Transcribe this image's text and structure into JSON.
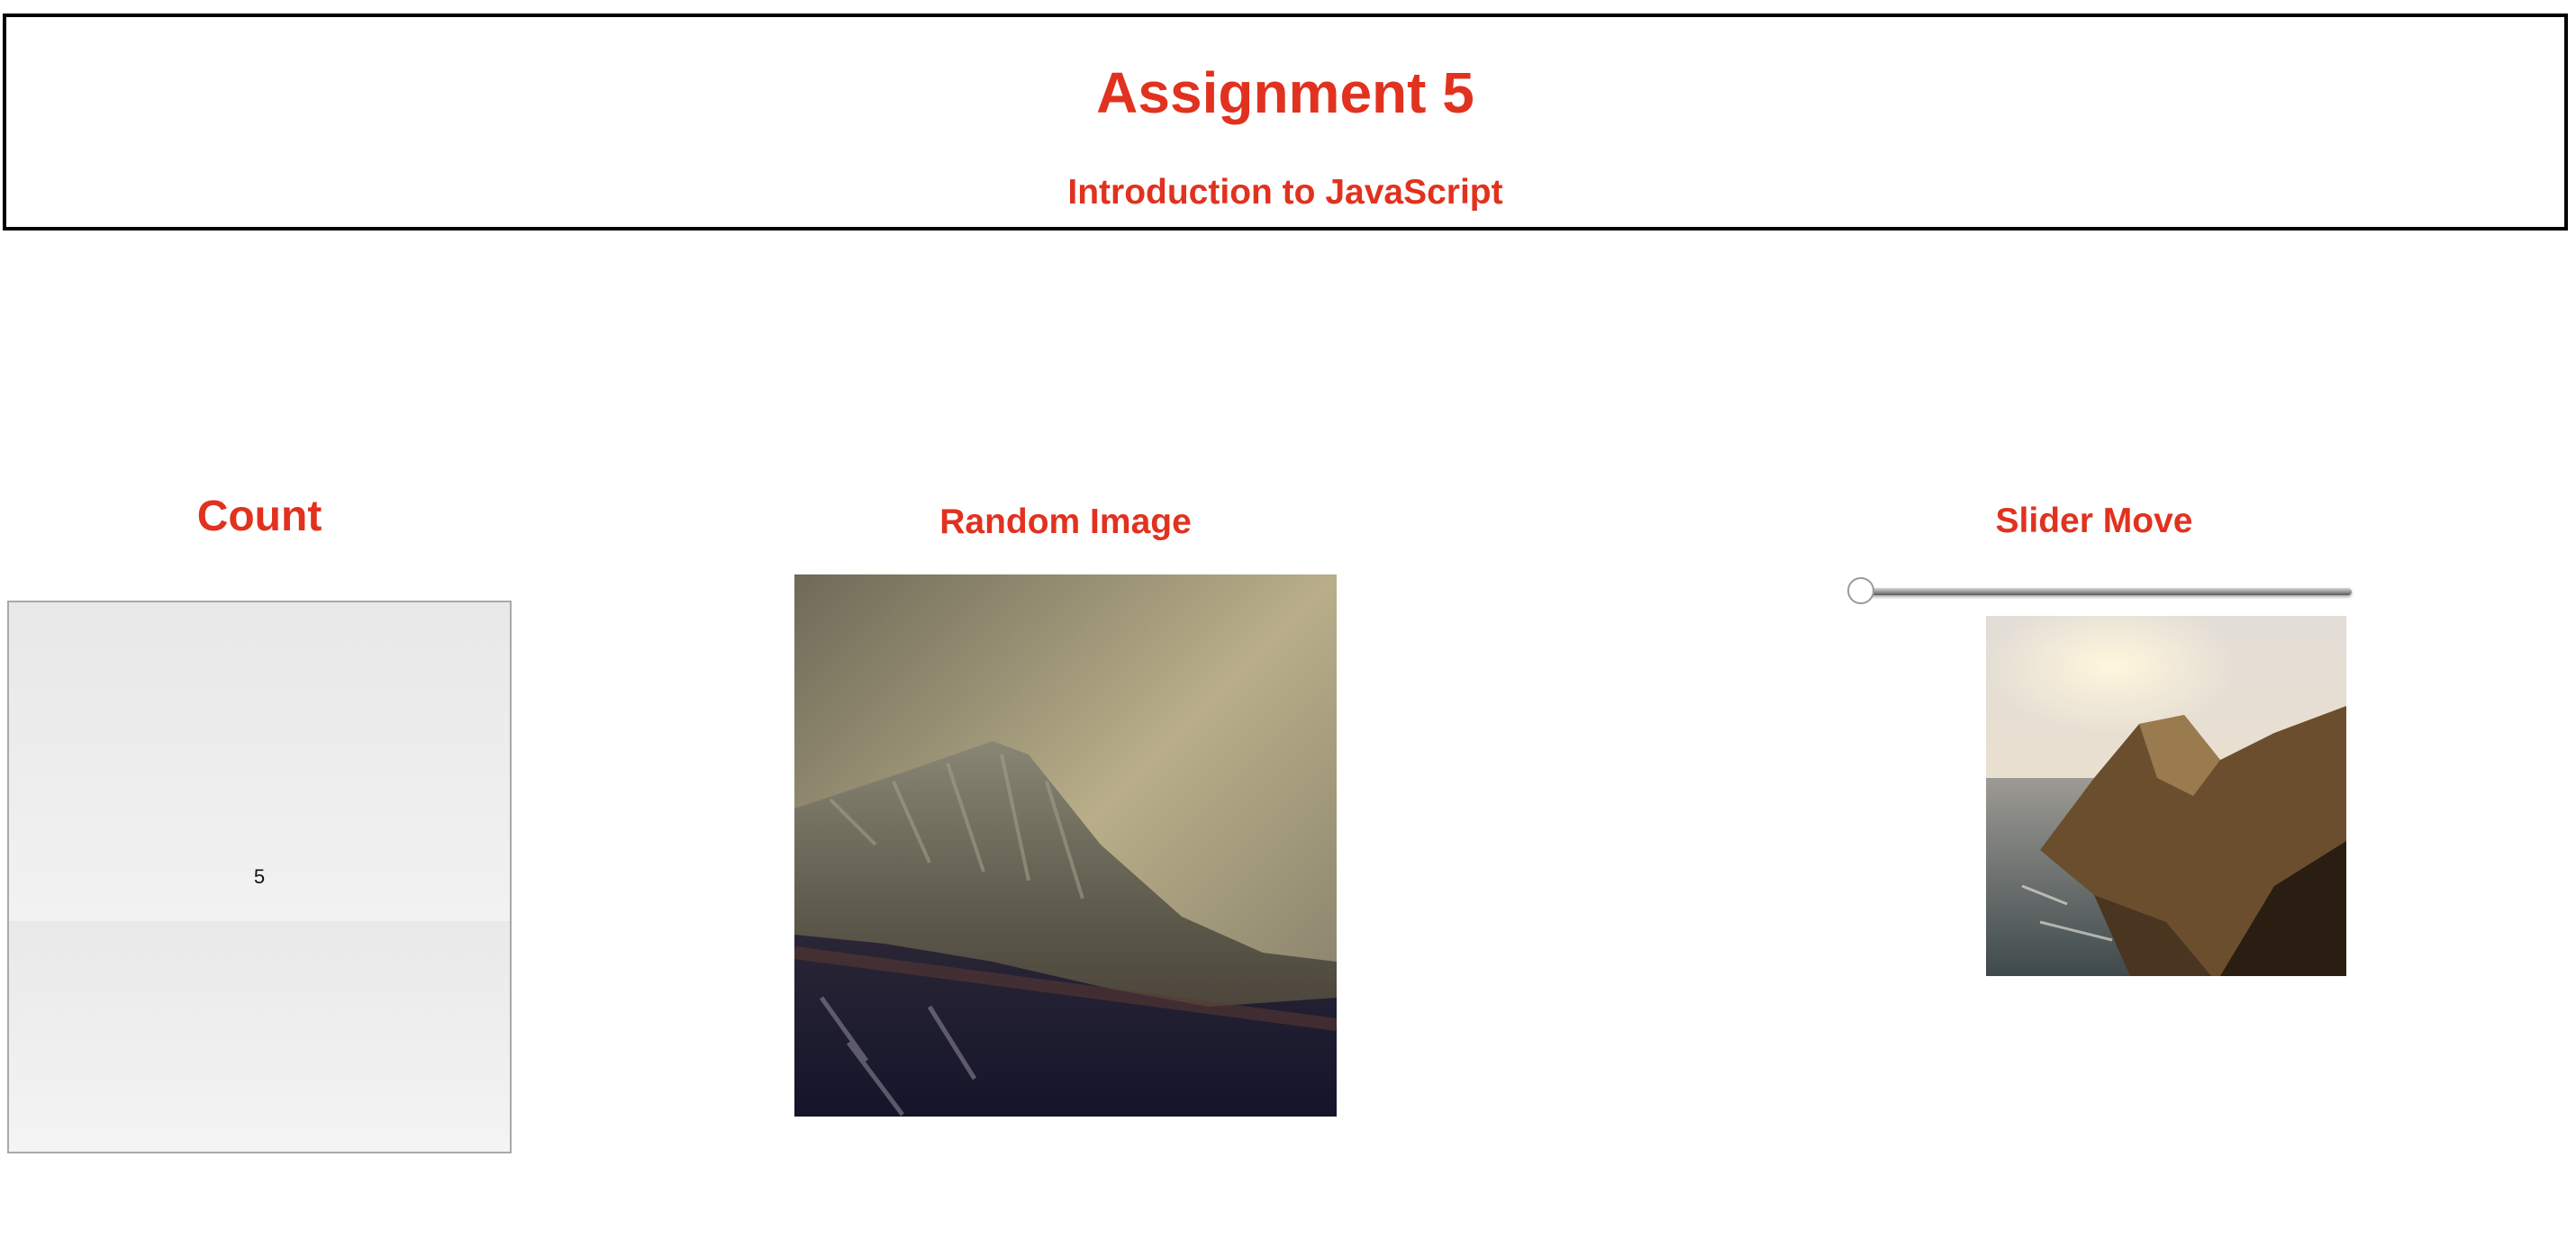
{
  "header": {
    "title": "Assignment 5",
    "subtitle": "Introduction to JavaScript"
  },
  "count": {
    "title": "Count",
    "value": "5"
  },
  "random_image": {
    "title": "Random Image",
    "subject": "foggy mountain peak"
  },
  "slider": {
    "title": "Slider Move",
    "value": 0,
    "image_subject": "coastal cliffs at sunset"
  },
  "colors": {
    "accent": "#e1321f",
    "border": "#000000"
  }
}
